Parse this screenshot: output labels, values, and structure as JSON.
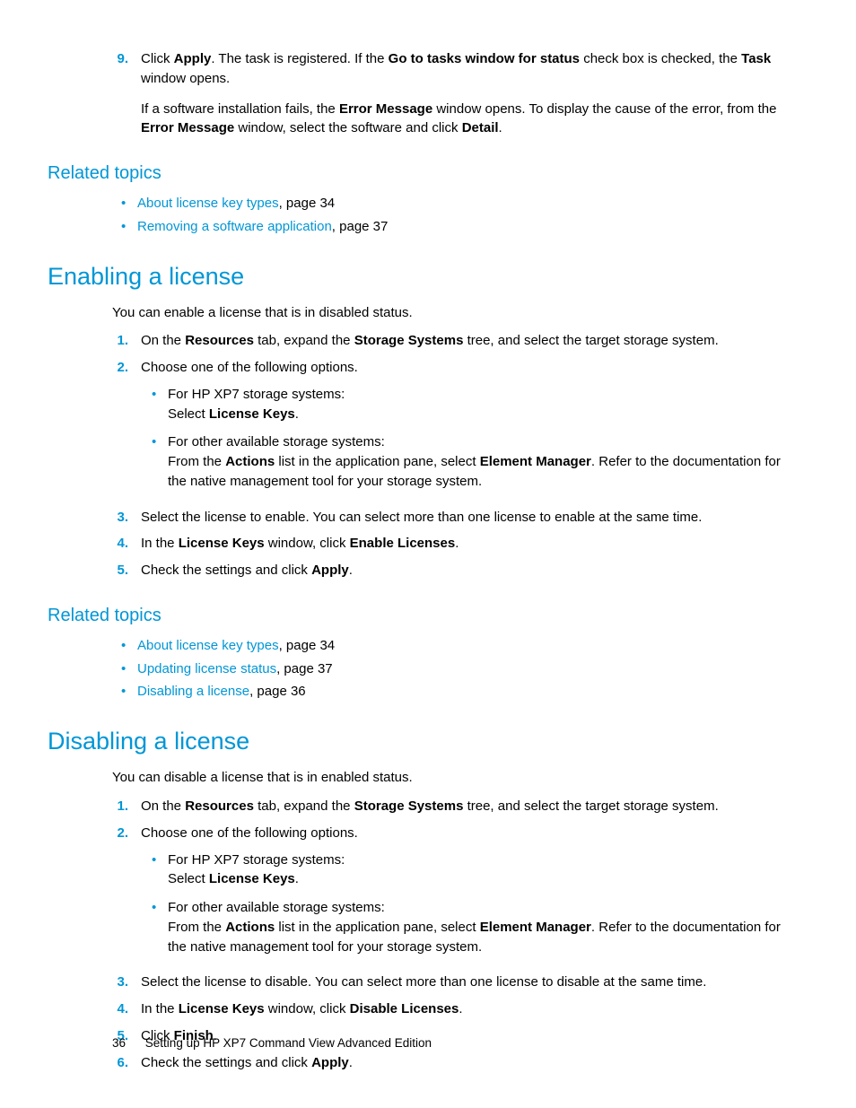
{
  "step9": {
    "num": "9.",
    "p1a": "Click ",
    "p1b": "Apply",
    "p1c": ". The task is registered. If the ",
    "p1d": "Go to tasks window for status",
    "p1e": " check box is checked, the ",
    "p1f": "Task",
    "p1g": " window opens.",
    "p2a": "If a software installation fails, the ",
    "p2b": "Error Message",
    "p2c": " window opens. To display the cause of the error, from the ",
    "p2d": "Error Message",
    "p2e": " window, select the software and click ",
    "p2f": "Detail",
    "p2g": "."
  },
  "related1": {
    "heading": "Related topics",
    "items": [
      {
        "link": "About license key types",
        "suffix": ", page 34"
      },
      {
        "link": "Removing a software application",
        "suffix": ", page 37"
      }
    ]
  },
  "enable": {
    "heading": "Enabling a license",
    "intro": "You can enable a license that is in disabled status.",
    "s1": {
      "n": "1.",
      "a": "On the ",
      "b": "Resources",
      "c": " tab, expand the ",
      "d": "Storage Systems",
      "e": " tree, and select the target storage system."
    },
    "s2": {
      "n": "2.",
      "a": "Choose one of the following options.",
      "b1a": "For HP XP7 storage systems:",
      "b1b": "Select ",
      "b1c": "License Keys",
      "b1d": ".",
      "b2a": "For other available storage systems:",
      "b2b": "From the ",
      "b2c": "Actions",
      "b2d": " list in the application pane, select ",
      "b2e": "Element Manager",
      "b2f": ". Refer to the documentation for the native management tool for your storage system."
    },
    "s3": {
      "n": "3.",
      "a": "Select the license to enable. You can select more than one license to enable at the same time."
    },
    "s4": {
      "n": "4.",
      "a": "In the ",
      "b": "License Keys",
      "c": " window, click ",
      "d": "Enable Licenses",
      "e": "."
    },
    "s5": {
      "n": "5.",
      "a": "Check the settings and click ",
      "b": "Apply",
      "c": "."
    }
  },
  "related2": {
    "heading": "Related topics",
    "items": [
      {
        "link": "About license key types",
        "suffix": ", page 34"
      },
      {
        "link": "Updating license status",
        "suffix": ", page 37"
      },
      {
        "link": "Disabling a license",
        "suffix": ", page 36"
      }
    ]
  },
  "disable": {
    "heading": "Disabling a license",
    "intro": "You can disable a license that is in enabled status.",
    "s1": {
      "n": "1.",
      "a": "On the ",
      "b": "Resources",
      "c": " tab, expand the ",
      "d": "Storage Systems",
      "e": " tree, and select the target storage system."
    },
    "s2": {
      "n": "2.",
      "a": "Choose one of the following options.",
      "b1a": "For HP XP7 storage systems:",
      "b1b": "Select ",
      "b1c": "License Keys",
      "b1d": ".",
      "b2a": "For other available storage systems:",
      "b2b": "From the ",
      "b2c": "Actions",
      "b2d": " list in the application pane, select ",
      "b2e": "Element Manager",
      "b2f": ". Refer to the documentation for the native management tool for your storage system."
    },
    "s3": {
      "n": "3.",
      "a": "Select the license to disable. You can select more than one license to disable at the same time."
    },
    "s4": {
      "n": "4.",
      "a": "In the ",
      "b": "License Keys",
      "c": " window, click ",
      "d": "Disable Licenses",
      "e": "."
    },
    "s5": {
      "n": "5.",
      "a": "Click ",
      "b": "Finish",
      "c": "."
    },
    "s6": {
      "n": "6.",
      "a": "Check the settings and click ",
      "b": "Apply",
      "c": "."
    }
  },
  "footer": {
    "page": "36",
    "title": "Setting up HP XP7 Command View Advanced Edition"
  }
}
